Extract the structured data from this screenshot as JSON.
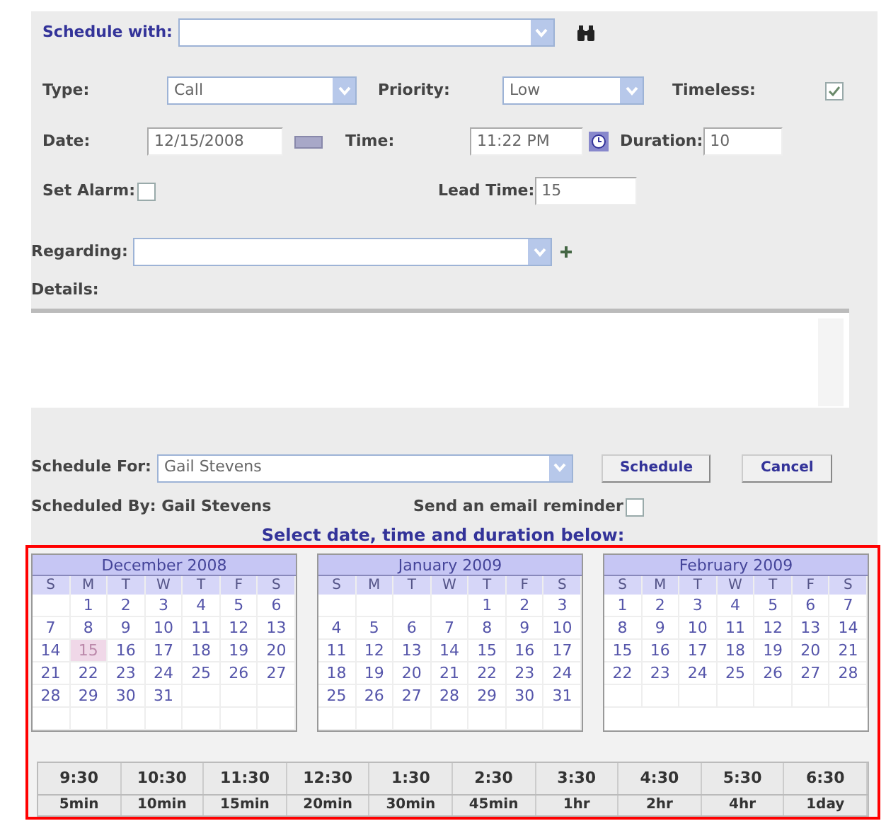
{
  "schedule_with": {
    "label": "Schedule with:"
  },
  "type": {
    "label": "Type:",
    "value": "Call"
  },
  "priority": {
    "label": "Priority:",
    "value": "Low"
  },
  "timeless": {
    "label": "Timeless:",
    "checked": true
  },
  "date": {
    "label": "Date:",
    "value": "12/15/2008"
  },
  "time": {
    "label": "Time:",
    "value": "11:22 PM"
  },
  "duration": {
    "label": "Duration:",
    "value": "10"
  },
  "set_alarm": {
    "label": "Set Alarm:",
    "checked": false
  },
  "lead_time": {
    "label": "Lead Time:",
    "value": "15"
  },
  "regarding": {
    "label": "Regarding:"
  },
  "details": {
    "label": "Details:"
  },
  "schedule_for": {
    "label": "Schedule For:",
    "value": "Gail Stevens"
  },
  "buttons": [
    "Schedule",
    "Cancel"
  ],
  "scheduled_by": "Scheduled By: Gail Stevens",
  "email_reminder": {
    "label": "Send an email reminder",
    "checked": false
  },
  "picker_title": "Select date, time and duration below:",
  "calendars": [
    {
      "title": "December 2008",
      "weekdays": [
        "S",
        "M",
        "T",
        "W",
        "T",
        "F",
        "S"
      ],
      "weeks": [
        [
          "1",
          "2",
          "3",
          "4",
          "5",
          "6"
        ],
        [
          "7",
          "8",
          "9",
          "10",
          "11",
          "12",
          "13"
        ],
        [
          "14",
          {
            "day": "15",
            "selected": true
          },
          "16",
          "17",
          "18",
          "19",
          "20"
        ],
        [
          "21",
          "22",
          "23",
          "24",
          "25",
          "26",
          "27"
        ],
        [
          "28",
          "29",
          "30",
          "31"
        ]
      ]
    },
    {
      "title": "January 2009",
      "weekdays": [
        "S",
        "M",
        "T",
        "W",
        "T",
        "F",
        "S"
      ],
      "weeks": [
        [
          "1",
          "2",
          "3"
        ],
        [
          "4",
          "5",
          "6",
          "7",
          "8",
          "9",
          "10"
        ],
        [
          "11",
          "12",
          "13",
          "14",
          "15",
          "16",
          "17"
        ],
        [
          "18",
          "19",
          "20",
          "21",
          "22",
          "23",
          "24"
        ],
        [
          "25",
          "26",
          "27",
          "28",
          "29",
          "30",
          "31"
        ]
      ]
    },
    {
      "title": "February 2009",
      "weekdays": [
        "S",
        "M",
        "T",
        "W",
        "T",
        "F",
        "S"
      ],
      "weeks": [
        [
          "1",
          "2",
          "3",
          "4",
          "5",
          "6",
          "7"
        ],
        [
          "8",
          "9",
          "10",
          "11",
          "12",
          "13",
          "14"
        ],
        [
          "15",
          "16",
          "17",
          "18",
          "19",
          "20",
          "21"
        ],
        [
          "22",
          "23",
          "24",
          "25",
          "26",
          "27",
          "28"
        ]
      ]
    }
  ],
  "times": [
    "9:30",
    "10:30",
    "11:30",
    "12:30",
    "1:30",
    "2:30",
    "3:30",
    "4:30",
    "5:30",
    "6:30"
  ],
  "durations": [
    "5min",
    "10min",
    "15min",
    "20min",
    "30min",
    "45min",
    "1hr",
    "2hr",
    "4hr",
    "1day"
  ]
}
